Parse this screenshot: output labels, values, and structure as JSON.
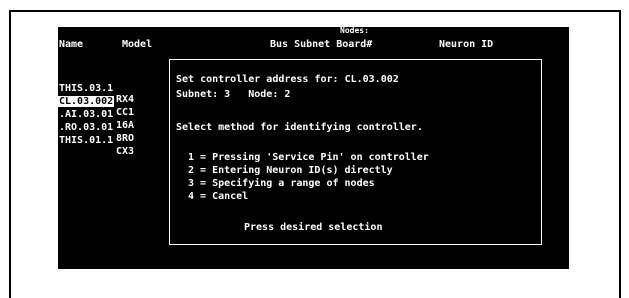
{
  "header": {
    "name": "Name",
    "model": "Model",
    "bus_subnet_board": "Bus Subnet Board#",
    "neuron_id": "Neuron ID",
    "fragment": "Nodes:"
  },
  "rows": [
    {
      "name": "THIS.03.1",
      "model": "RX4"
    },
    {
      "name": "CL.03.002",
      "model": "CC1"
    },
    {
      "name": ".AI.03.01",
      "model": "16A"
    },
    {
      "name": ".RO.03.01",
      "model": "8RO"
    },
    {
      "name": "THIS.01.1",
      "model": "CX3"
    }
  ],
  "dialog": {
    "line1": "Set controller address for: CL.03.002",
    "line2": "Subnet: 3   Node: 2",
    "line3": "Select method for identifying controller.",
    "options": [
      "1 = Pressing 'Service Pin' on controller",
      "2 = Entering Neuron ID(s) directly",
      "3 = Specifying a range of nodes",
      "4 = Cancel"
    ],
    "prompt": "Press desired selection"
  }
}
